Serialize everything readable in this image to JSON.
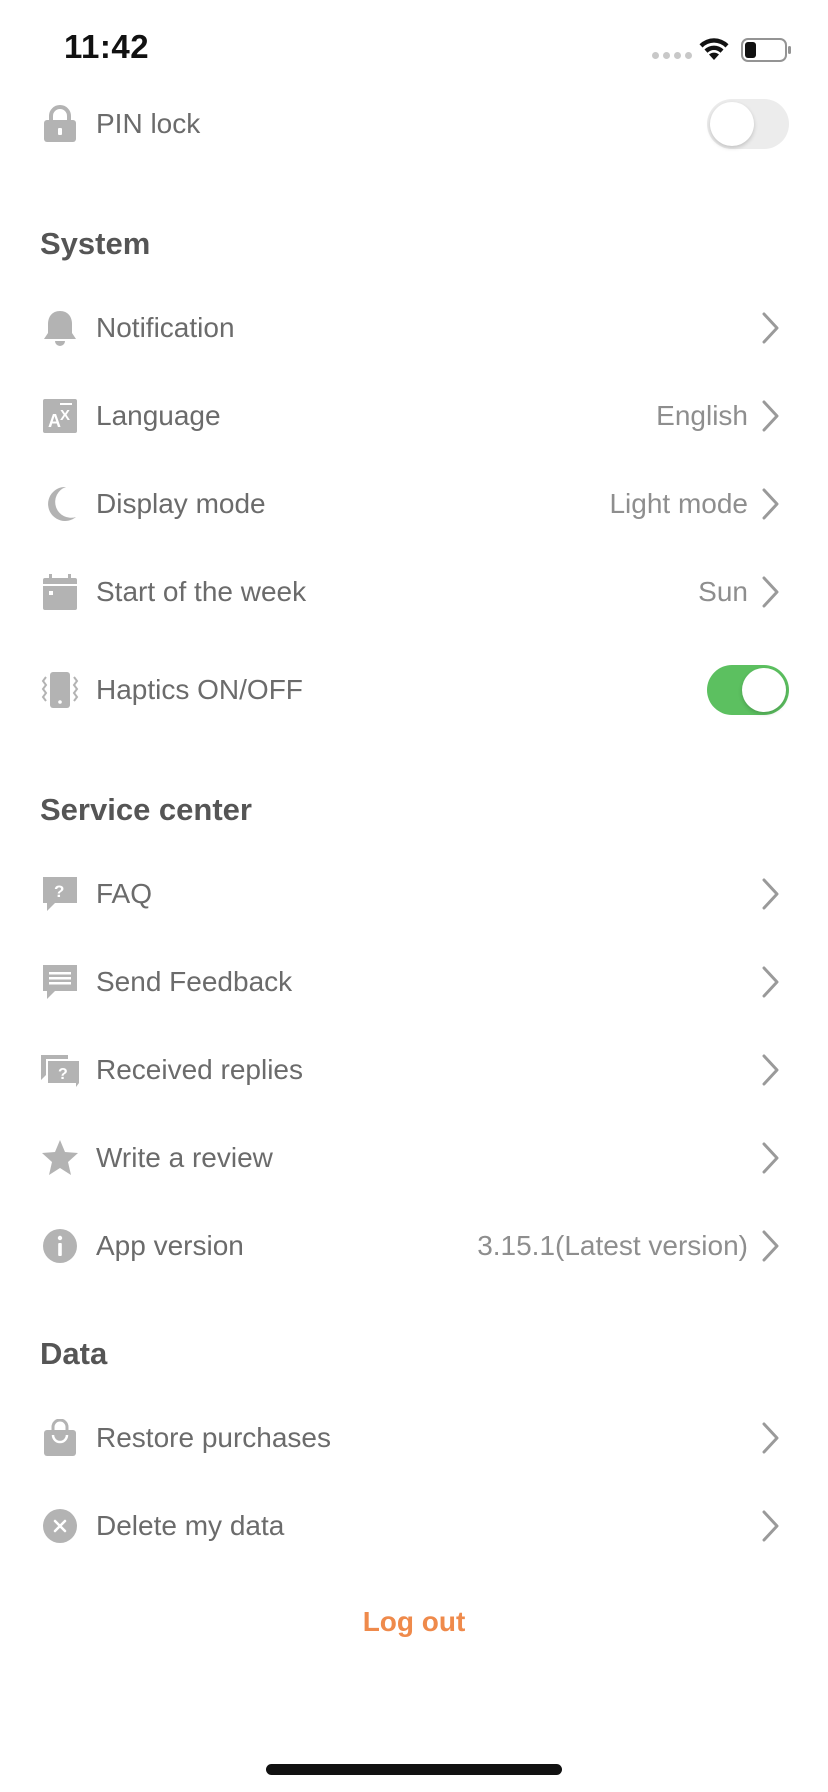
{
  "status_bar": {
    "time": "11:42"
  },
  "pin_lock": {
    "label": "PIN lock",
    "enabled": false
  },
  "system": {
    "title": "System",
    "items": [
      {
        "label": "Notification",
        "value": ""
      },
      {
        "label": "Language",
        "value": "English"
      },
      {
        "label": "Display mode",
        "value": "Light mode"
      },
      {
        "label": "Start of the week",
        "value": "Sun"
      }
    ],
    "haptics": {
      "label": "Haptics ON/OFF",
      "enabled": true
    }
  },
  "service_center": {
    "title": "Service center",
    "items": [
      {
        "label": "FAQ",
        "value": ""
      },
      {
        "label": "Send Feedback",
        "value": ""
      },
      {
        "label": "Received replies",
        "value": ""
      },
      {
        "label": "Write a review",
        "value": ""
      },
      {
        "label": "App version",
        "value": "3.15.1(Latest version)"
      }
    ]
  },
  "data_section": {
    "title": "Data",
    "items": [
      {
        "label": "Restore purchases",
        "value": ""
      },
      {
        "label": "Delete my data",
        "value": ""
      }
    ]
  },
  "logout_label": "Log out",
  "colors": {
    "accent": "#ef8a4b",
    "toggle_on": "#5cc060",
    "icon_gray": "#b3b3b3"
  }
}
